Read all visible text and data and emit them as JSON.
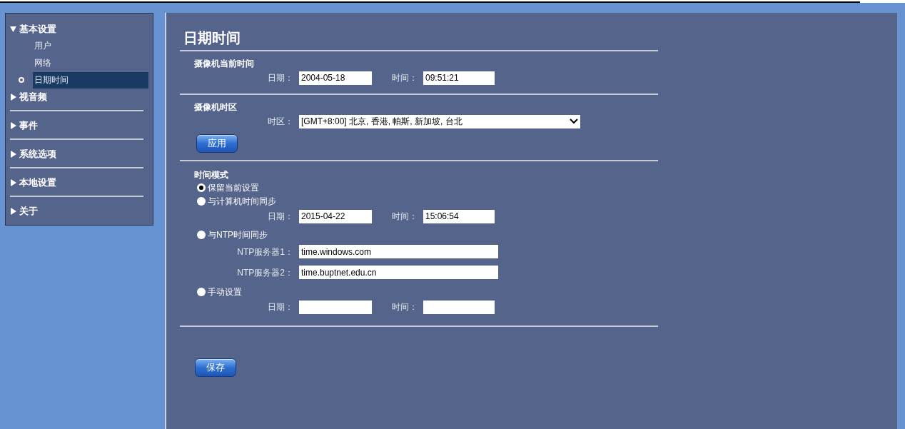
{
  "sidebar": {
    "groups": [
      {
        "label": "基本设置",
        "expanded": true,
        "children": [
          {
            "label": "用户",
            "selected": false
          },
          {
            "label": "网络",
            "selected": false
          },
          {
            "label": "日期时间",
            "selected": true
          }
        ]
      },
      {
        "label": "视音频",
        "expanded": false
      },
      {
        "label": "事件",
        "expanded": false
      },
      {
        "label": "系统选项",
        "expanded": false
      },
      {
        "label": "本地设置",
        "expanded": false
      },
      {
        "label": "关于",
        "expanded": false
      }
    ]
  },
  "title": "日期时间",
  "current_time": {
    "heading": "摄像机当前时间",
    "fields": [
      {
        "label": "日期：",
        "value": "2004-05-18"
      },
      {
        "label": "时间：",
        "value": "09:51:21"
      }
    ]
  },
  "timezone": {
    "heading": "摄像机时区",
    "label": "时区：",
    "value": "[GMT+8:00] 北京, 香港, 帕斯, 新加坡, 台北",
    "button": "应用"
  },
  "time_mode": {
    "heading": "时间模式",
    "options": [
      {
        "label": "保留当前设置",
        "selected": true,
        "kind": "plain"
      },
      {
        "label": "与计算机时间同步",
        "selected": false,
        "kind": "datetime",
        "fields": [
          {
            "label": "日期：",
            "value": "2015-04-22"
          },
          {
            "label": "时间：",
            "value": "15:06:54"
          }
        ]
      },
      {
        "label": "与NTP时间同步",
        "selected": false,
        "kind": "servers",
        "fields": [
          {
            "label": "NTP服务器1：",
            "value": "time.windows.com"
          },
          {
            "label": "NTP服务器2：",
            "value": "time.buptnet.edu.cn"
          }
        ]
      },
      {
        "label": "手动设置",
        "selected": false,
        "kind": "datetime",
        "fields": [
          {
            "label": "日期："
          },
          {
            "label": "时间："
          }
        ]
      }
    ]
  },
  "save_button": "保存"
}
